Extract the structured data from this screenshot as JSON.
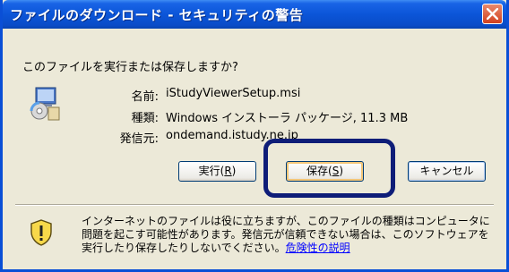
{
  "window": {
    "title": "ファイルのダウンロード - セキュリティの警告"
  },
  "dialog": {
    "question": "このファイルを実行または保存しますか?",
    "file": {
      "name_label": "名前:",
      "name_value": "iStudyViewerSetup.msi",
      "type_label": "種類:",
      "type_value": "Windows インストーラ パッケージ, 11.3 MB",
      "source_label": "発信元:",
      "source_value": "ondemand.istudy.ne.jp"
    },
    "buttons": {
      "run_label": "実行(",
      "run_key": "R",
      "run_suffix": ")",
      "save_label": "保存(",
      "save_key": "S",
      "save_suffix": ")",
      "cancel_label": "キャンセル"
    },
    "warning": {
      "text": "インターネットのファイルは役に立ちますが、このファイルの種類はコンピュータに問題を起こす可能性があります。発信元が信頼できない場合は、このソフトウェアを実行したり保存したりしないでください。",
      "link": "危険性の説明"
    }
  },
  "colors": {
    "titlebar": "#0b55d8",
    "highlight_border": "#0e1d78",
    "link": "#0000ff"
  },
  "icons": [
    "close-icon",
    "msi-file-icon",
    "shield-warning-icon"
  ]
}
